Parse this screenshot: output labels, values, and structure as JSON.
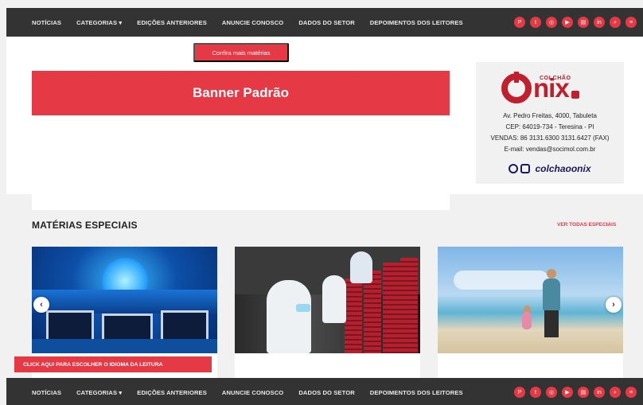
{
  "nav": {
    "items": [
      "NOTÍCIAS",
      "CATEGORIAS ▾",
      "EDIÇÕES ANTERIORES",
      "ANUNCIE CONOSCO",
      "DADOS DO SETOR",
      "DEPOIMENTOS DOS LEITORES"
    ],
    "icons": [
      "pinterest-icon",
      "twitter-icon",
      "instagram-icon",
      "youtube-icon",
      "newspaper-icon",
      "linkedin-icon",
      "search-icon",
      "menu-icon"
    ]
  },
  "top": {
    "more_button": "Confira mais matérias",
    "banner_label": "Banner Padrão"
  },
  "ad": {
    "brand_small": "COLCHÃO",
    "brand": "nix",
    "address": "Av. Pedro Freitas, 4000, Tabuleta",
    "cep": "CEP: 64019-734 - Teresina - PI",
    "phones": "VENDAS: 86 3131.6300 3131.6427 (FAX)",
    "email": "E-mail: vendas@socimol.com.br",
    "handle": "colchaoonix"
  },
  "special": {
    "title": "MATÉRIAS ESPECIAIS",
    "see_all": "VER TODAS ESPECIAIS"
  },
  "carousel": {
    "prev": "‹",
    "next": "›"
  },
  "language_bar": "CLICK AQUI PARA ESCOLHER O IDIOMA DA LEITURA",
  "colors": {
    "accent": "#e63946",
    "navbar": "#333333",
    "brand": "#c0202e"
  }
}
